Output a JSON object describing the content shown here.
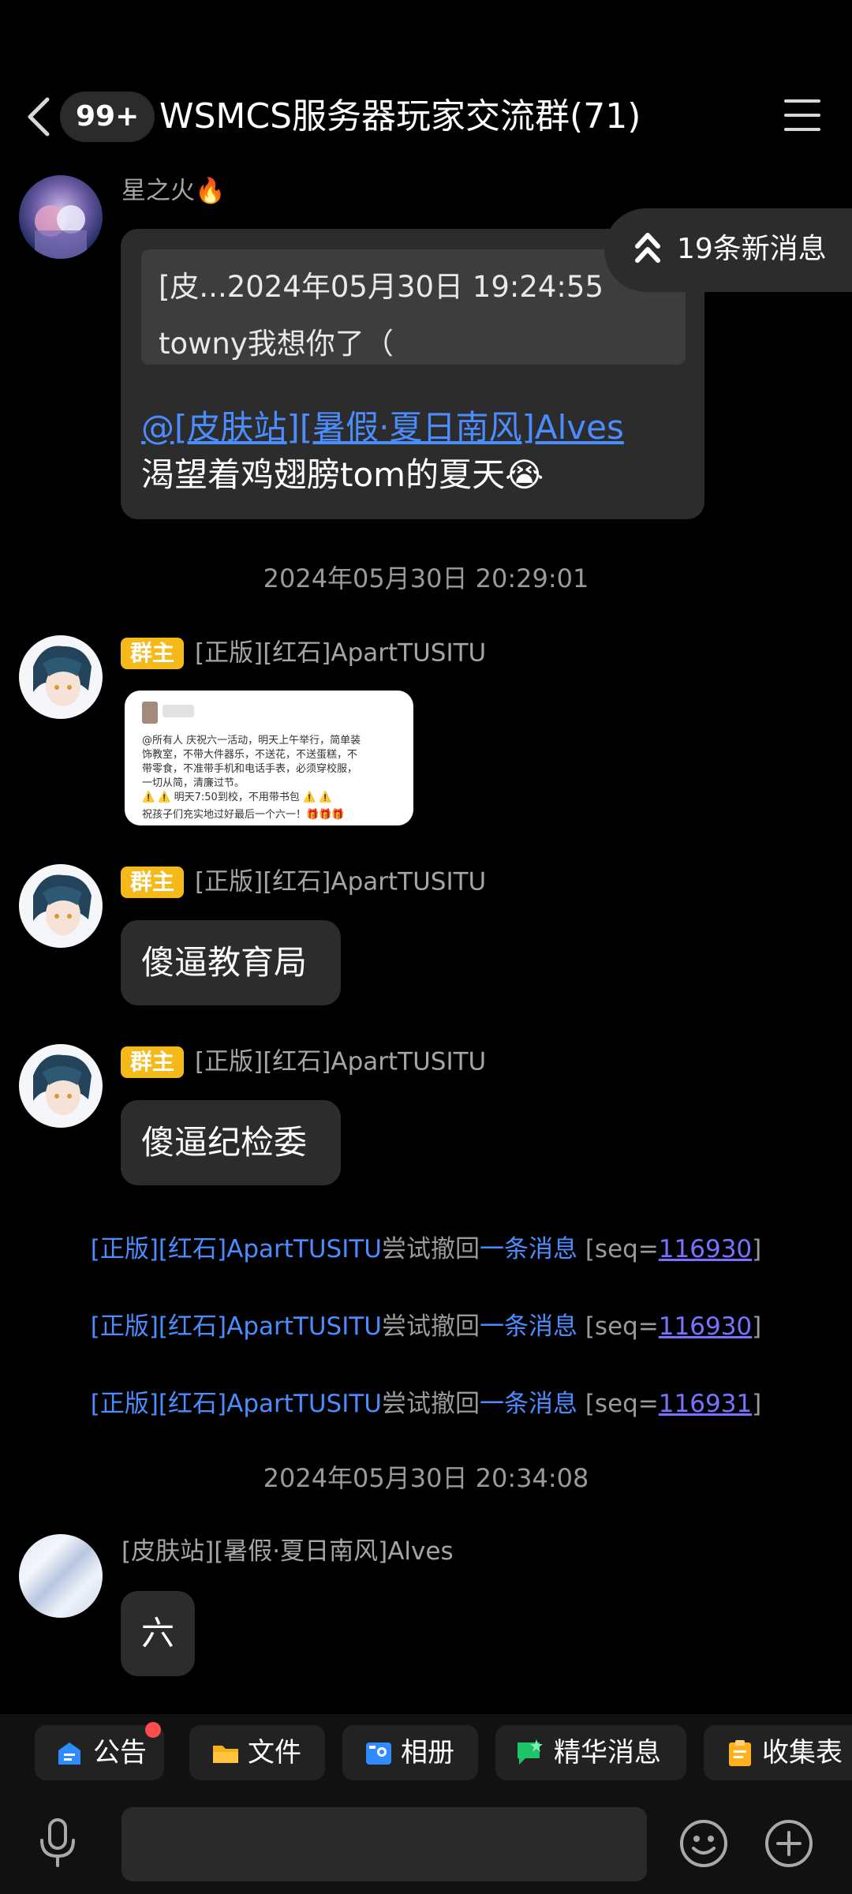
{
  "header": {
    "unread_count": "99+",
    "title": "WSMCS服务器玩家交流群(71)"
  },
  "new_messages_pill": "19条新消息",
  "messages": [
    {
      "sender": "星之火🔥",
      "reply_quote_line1": "[皮...2024年05月30日 19:24:55",
      "reply_quote_line2": "towny我想你了（",
      "mention": "@[皮肤站][暑假·夏日南风]Alves",
      "text": "渴望着鸡翅膀tom的夏天😭"
    },
    {
      "badge": "群主",
      "sender": "[正版][红石]ApartTUSITU",
      "image_text": [
        "@所有人 庆祝六一活动，明天上午举行，简单装",
        "饰教室，不带大件器乐，不送花，不送蛋糕，不",
        "带零食，不准带手机和电话手表，必须穿校服，",
        "一切从简，清廉过节。",
        "⚠️ ⚠️ 明天7:50到校，不用带书包 ⚠️ ⚠️",
        "祝孩子们充实地过好最后一个六一！🎁🎁🎁"
      ]
    },
    {
      "badge": "群主",
      "sender": "[正版][红石]ApartTUSITU",
      "text": "傻逼教育局"
    },
    {
      "badge": "群主",
      "sender": "[正版][红石]ApartTUSITU",
      "text": "傻逼纪检委"
    },
    {
      "sender": "[皮肤站][暑假·夏日南风]Alves",
      "text": "六"
    }
  ],
  "timestamps": [
    "2024年05月30日 20:29:01",
    "2024年05月30日 20:34:08"
  ],
  "system_notes": [
    {
      "name": "[正版][红石]ApartTUSITU",
      "action": "尝试撤回",
      "link": "一条消息",
      "seq_prefix": " [seq=",
      "seq": "116930",
      "seq_suffix": "]"
    },
    {
      "name": "[正版][红石]ApartTUSITU",
      "action": "尝试撤回",
      "link": "一条消息",
      "seq_prefix": " [seq=",
      "seq": "116930",
      "seq_suffix": "]"
    },
    {
      "name": "[正版][红石]ApartTUSITU",
      "action": "尝试撤回",
      "link": "一条消息",
      "seq_prefix": " [seq=",
      "seq": "116931",
      "seq_suffix": "]"
    }
  ],
  "toolbar": {
    "announcement": "公告",
    "files": "文件",
    "album": "相册",
    "essence": "精华消息",
    "collect": "收集表"
  },
  "input": {
    "placeholder": ""
  },
  "colors": {
    "background": "#000000",
    "bubble": "#2c2c2c",
    "link": "#4b8dff",
    "owner_badge": "#f5b91a"
  }
}
